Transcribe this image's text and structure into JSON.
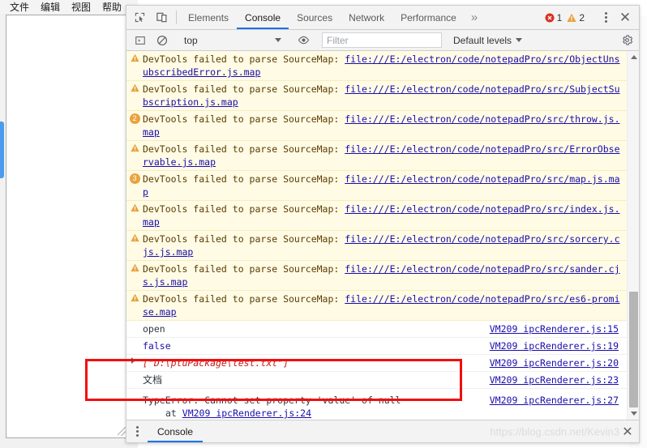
{
  "app_window": {
    "menu_items": [
      "文件",
      "编辑",
      "视图",
      "帮助"
    ],
    "textarea_value": ""
  },
  "devtools": {
    "tabbar": {
      "inspect_icon": "inspect-cursor-icon",
      "device_icon": "device-toolbar-icon",
      "tabs": [
        {
          "label": "Elements",
          "active": false
        },
        {
          "label": "Console",
          "active": true
        },
        {
          "label": "Sources",
          "active": false
        },
        {
          "label": "Network",
          "active": false
        },
        {
          "label": "Performance",
          "active": false
        }
      ],
      "more_label": "»",
      "error_count": "1",
      "warning_count": "2",
      "error_color": "#d93025",
      "warning_color": "#e8a33d",
      "menu_icon": "kebab-menu-icon",
      "close_label": "✕"
    },
    "filterbar": {
      "sidebar_toggle_icon": "console-sidebar-icon",
      "clear_icon": "clear-console-icon",
      "context_value": "top",
      "live_expression_icon": "eye-icon",
      "filter_placeholder": "Filter",
      "filter_value": "",
      "levels_label": "Default levels",
      "settings_icon": "gear-icon"
    },
    "messages": [
      {
        "type": "warn",
        "icon": "warning-triangle-icon",
        "badge": "",
        "text": "DevTools failed to parse SourceMap: ",
        "link": "file:///E:/electron/code/notepadPro/src/ObjectUnsubscribedError.js.map",
        "source": ""
      },
      {
        "type": "warn",
        "icon": "warning-triangle-icon",
        "badge": "",
        "text": "DevTools failed to parse SourceMap: ",
        "link": "file:///E:/electron/code/notepadPro/src/SubjectSubscription.js.map",
        "source": ""
      },
      {
        "type": "warn",
        "icon": "count-badge",
        "badge": "2",
        "text": "DevTools failed to parse SourceMap: ",
        "link": "file:///E:/electron/code/notepadPro/src/throw.js.map",
        "source": ""
      },
      {
        "type": "warn",
        "icon": "warning-triangle-icon",
        "badge": "",
        "text": "DevTools failed to parse SourceMap: ",
        "link": "file:///E:/electron/code/notepadPro/src/ErrorObservable.js.map",
        "source": ""
      },
      {
        "type": "warn",
        "icon": "count-badge",
        "badge": "3",
        "text": "DevTools failed to parse SourceMap: ",
        "link": "file:///E:/electron/code/notepadPro/src/map.js.map",
        "source": ""
      },
      {
        "type": "warn",
        "icon": "warning-triangle-icon",
        "badge": "",
        "text": "DevTools failed to parse SourceMap: ",
        "link": "file:///E:/electron/code/notepadPro/src/index.js.map",
        "source": ""
      },
      {
        "type": "warn",
        "icon": "warning-triangle-icon",
        "badge": "",
        "text": "DevTools failed to parse SourceMap: ",
        "link": "file:///E:/electron/code/notepadPro/src/sorcery.cjs.js.map",
        "source": ""
      },
      {
        "type": "warn",
        "icon": "warning-triangle-icon",
        "badge": "",
        "text": "DevTools failed to parse SourceMap: ",
        "link": "file:///E:/electron/code/notepadPro/src/sander.cjs.js.map",
        "source": ""
      },
      {
        "type": "warn",
        "icon": "warning-triangle-icon",
        "badge": "",
        "text": "DevTools failed to parse SourceMap: ",
        "link": "file:///E:/electron/code/notepadPro/src/es6-promise.map",
        "source": ""
      },
      {
        "type": "log",
        "icon": "",
        "badge": "",
        "text": "open",
        "link": "",
        "source": "VM209 ipcRenderer.js:15"
      },
      {
        "type": "log-bool",
        "icon": "",
        "badge": "",
        "text": "false",
        "link": "",
        "source": "VM209 ipcRenderer.js:19"
      },
      {
        "type": "log-array",
        "icon": "expand-arrow-icon",
        "badge": "",
        "text": "[\"D:\\ptuPackage\\test.txt\"]",
        "link": "",
        "source": "VM209 ipcRenderer.js:20"
      },
      {
        "type": "log-cjk",
        "icon": "",
        "badge": "",
        "text": "文档",
        "link": "",
        "source": "VM209 ipcRenderer.js:23"
      },
      {
        "type": "error",
        "icon": "",
        "badge": "",
        "text": "TypeError: Cannot set property 'value' of null",
        "stack_prefix": "at ",
        "stack_link": "VM209 ipcRenderer.js:24",
        "source": "VM209 ipcRenderer.js:27"
      }
    ],
    "prompt": {
      "chevron": "›",
      "value": ""
    },
    "drawer": {
      "menu_icon": "kebab-menu-icon",
      "tab_label": "Console",
      "close_label": "✕",
      "watermark": "https://blog.csdn.net/Kevin3"
    }
  },
  "annotation": {
    "color": "#f40d0d",
    "shape": "rectangle"
  }
}
